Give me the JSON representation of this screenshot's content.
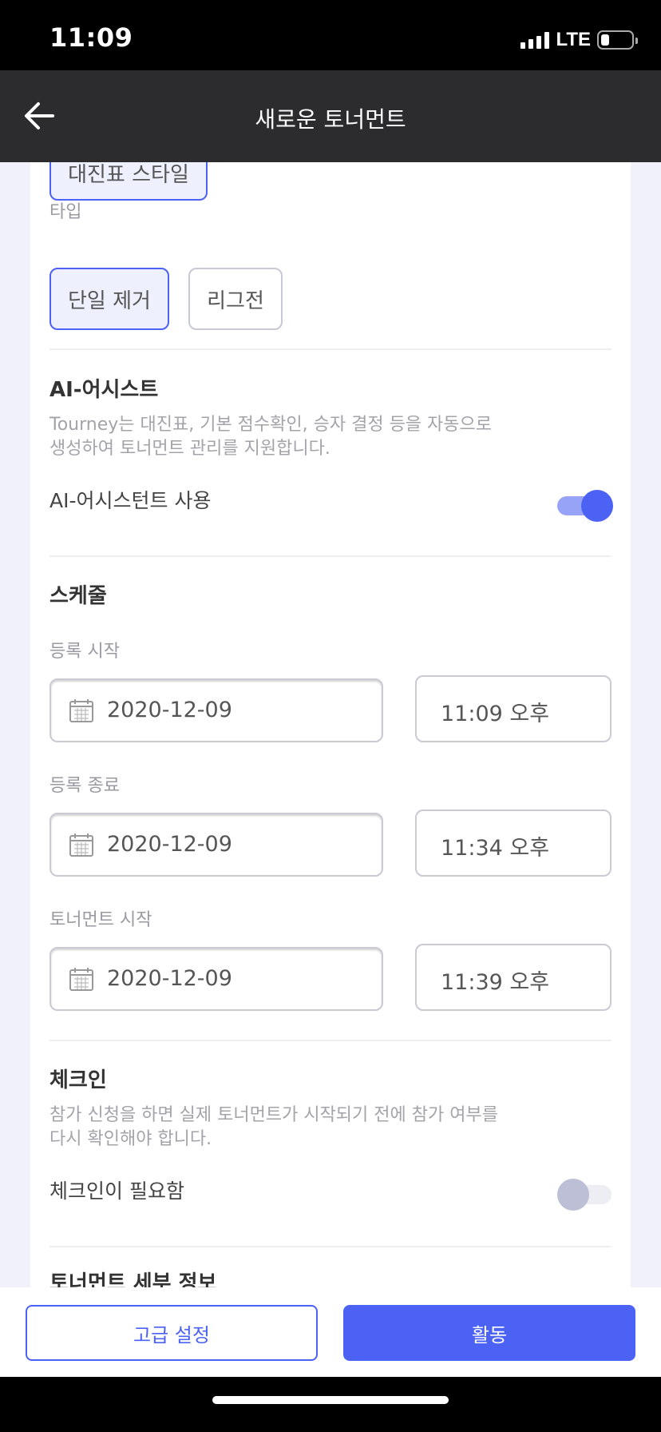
{
  "status_bar": {
    "time": "11:09",
    "network": "LTE"
  },
  "nav": {
    "title": "새로운 토너먼트"
  },
  "format": {
    "partial_button_label": "대진표 스타일"
  },
  "type_section": {
    "label": "타입",
    "options": [
      {
        "label": "단일 제거",
        "selected": true
      },
      {
        "label": "리그전",
        "selected": false
      }
    ]
  },
  "ai_assist": {
    "title": "AI-어시스트",
    "description_line1": "Tourney는 대진표, 기본 점수확인, 승자 결정 등을 자동으로",
    "description_line2": "생성하여 토너먼트 관리를 지원합니다.",
    "toggle_label": "AI-어시스턴트 사용",
    "enabled": true
  },
  "schedule": {
    "title": "스케줄",
    "rows": [
      {
        "label": "등록 시작",
        "date": "2020-12-09",
        "time": "11:09 오후"
      },
      {
        "label": "등록 종료",
        "date": "2020-12-09",
        "time": "11:34 오후"
      },
      {
        "label": "토너먼트 시작",
        "date": "2020-12-09",
        "time": "11:39 오후"
      }
    ]
  },
  "checkin": {
    "title": "체크인",
    "description_line1": "참가 신청을 하면 실제 토너먼트가 시작되기 전에 참가 여부를",
    "description_line2": "다시 확인해야 합니다.",
    "toggle_label": "체크인이 필요함",
    "enabled": false
  },
  "details": {
    "title": "토너먼트 세부 정보"
  },
  "footer": {
    "advanced_label": "고급 설정",
    "activate_label": "활동"
  },
  "colors": {
    "accent": "#4c62f5",
    "nav_bg": "#2c2c2e",
    "page_bg": "#f0f1fa"
  }
}
